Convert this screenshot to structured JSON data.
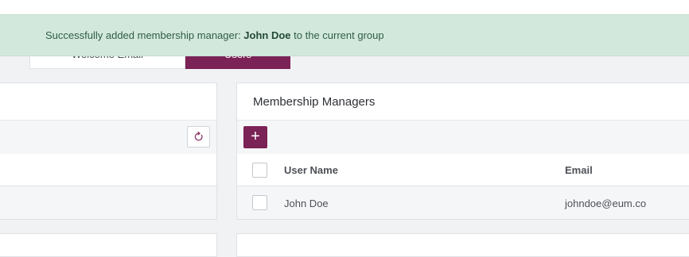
{
  "tabs": {
    "welcome_label": "Welcome Email",
    "users_label": "Users"
  },
  "toast": {
    "prefix": "Successfully added membership manager: ",
    "name": "John Doe",
    "suffix": " to the current group"
  },
  "membership_managers": {
    "title": "Membership Managers",
    "add_label": "+",
    "columns": {
      "user_name": "User Name",
      "email": "Email"
    },
    "rows": [
      {
        "user_name": "John Doe",
        "email": "johndoe@eum.co"
      }
    ]
  },
  "colors": {
    "accent": "#7b2256",
    "toast_bg": "#d3e8dd",
    "toast_text": "#2f5e44"
  },
  "icons": {
    "refresh": "refresh-icon",
    "add": "plus-icon"
  }
}
